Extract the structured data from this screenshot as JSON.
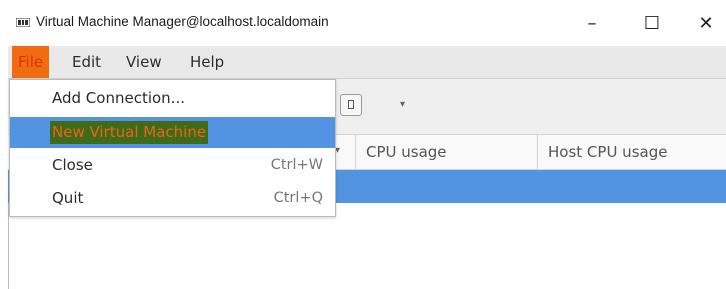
{
  "window": {
    "title": "Virtual Machine Manager@localhost.localdomain",
    "minimize": "–",
    "maximize": "☐",
    "close": "✕"
  },
  "menubar": {
    "items": [
      "File",
      "Edit",
      "View",
      "Help"
    ],
    "active": "File"
  },
  "toolbar": {
    "dropdown_arrow": "▾"
  },
  "columns": {
    "sort_arrow": "▾",
    "cpu": "CPU usage",
    "host_cpu": "Host CPU usage"
  },
  "file_menu": {
    "items": [
      {
        "label": "Add Connection...",
        "accel": ""
      },
      {
        "label": "New Virtual Machine",
        "accel": ""
      },
      {
        "label": "Close",
        "accel": "Ctrl+W"
      },
      {
        "label": "Quit",
        "accel": "Ctrl+Q"
      }
    ],
    "highlighted": "New Virtual Machine"
  },
  "colors": {
    "selection": "#5294e2",
    "file_menu_active": "#f06c11",
    "highlight_text_bg": "#3f6b18"
  }
}
